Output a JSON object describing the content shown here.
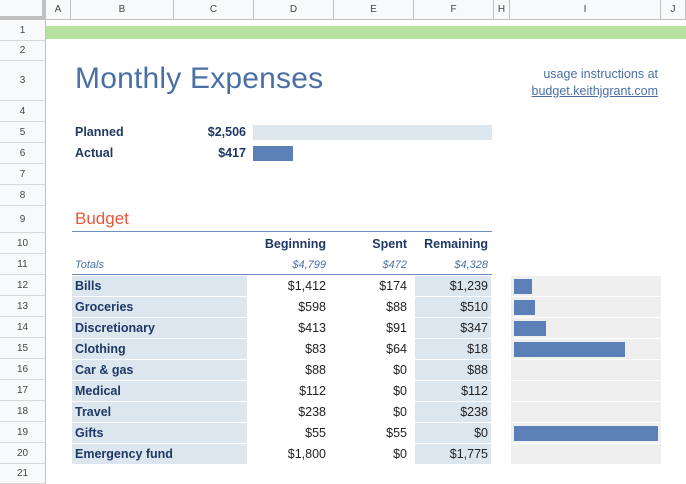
{
  "columns": [
    "A",
    "B",
    "C",
    "D",
    "E",
    "F",
    "H",
    "I",
    "J"
  ],
  "rows": [
    "1",
    "2",
    "3",
    "4",
    "5",
    "6",
    "7",
    "8",
    "9",
    "10",
    "11",
    "12",
    "13",
    "14",
    "15",
    "16",
    "17",
    "18",
    "19",
    "20",
    "21"
  ],
  "title": "Monthly Expenses",
  "instructions": {
    "line1": "usage instructions at",
    "link": "budget.keithjgrant.com"
  },
  "summary": {
    "planned_label": "Planned",
    "planned_value": "$2,506",
    "actual_label": "Actual",
    "actual_value": "$417",
    "actual_fraction_of_planned": 0.166
  },
  "budget": {
    "heading": "Budget",
    "headers": {
      "beginning": "Beginning",
      "spent": "Spent",
      "remaining": "Remaining"
    },
    "totals": {
      "label": "Totals",
      "beginning": "$4,799",
      "spent": "$472",
      "remaining": "$4,328"
    },
    "items": [
      {
        "name": "Bills",
        "beginning": "$1,412",
        "spent": "$174",
        "remaining": "$1,239",
        "spent_fraction": 0.123
      },
      {
        "name": "Groceries",
        "beginning": "$598",
        "spent": "$88",
        "remaining": "$510",
        "spent_fraction": 0.147
      },
      {
        "name": "Discretionary",
        "beginning": "$413",
        "spent": "$91",
        "remaining": "$347",
        "spent_fraction": 0.22
      },
      {
        "name": "Clothing",
        "beginning": "$83",
        "spent": "$64",
        "remaining": "$18",
        "spent_fraction": 0.77
      },
      {
        "name": "Car & gas",
        "beginning": "$88",
        "spent": "$0",
        "remaining": "$88",
        "spent_fraction": 0
      },
      {
        "name": "Medical",
        "beginning": "$112",
        "spent": "$0",
        "remaining": "$112",
        "spent_fraction": 0
      },
      {
        "name": "Travel",
        "beginning": "$238",
        "spent": "$0",
        "remaining": "$238",
        "spent_fraction": 0
      },
      {
        "name": "Gifts",
        "beginning": "$55",
        "spent": "$55",
        "remaining": "$0",
        "spent_fraction": 1.0
      },
      {
        "name": "Emergency fund",
        "beginning": "$1,800",
        "spent": "$0",
        "remaining": "$1,775",
        "spent_fraction": 0
      }
    ]
  },
  "colors": {
    "accent": "#4a6fa5",
    "heading": "#e8573a",
    "bar": "#5b80b8",
    "band": "#b7e1a1"
  }
}
